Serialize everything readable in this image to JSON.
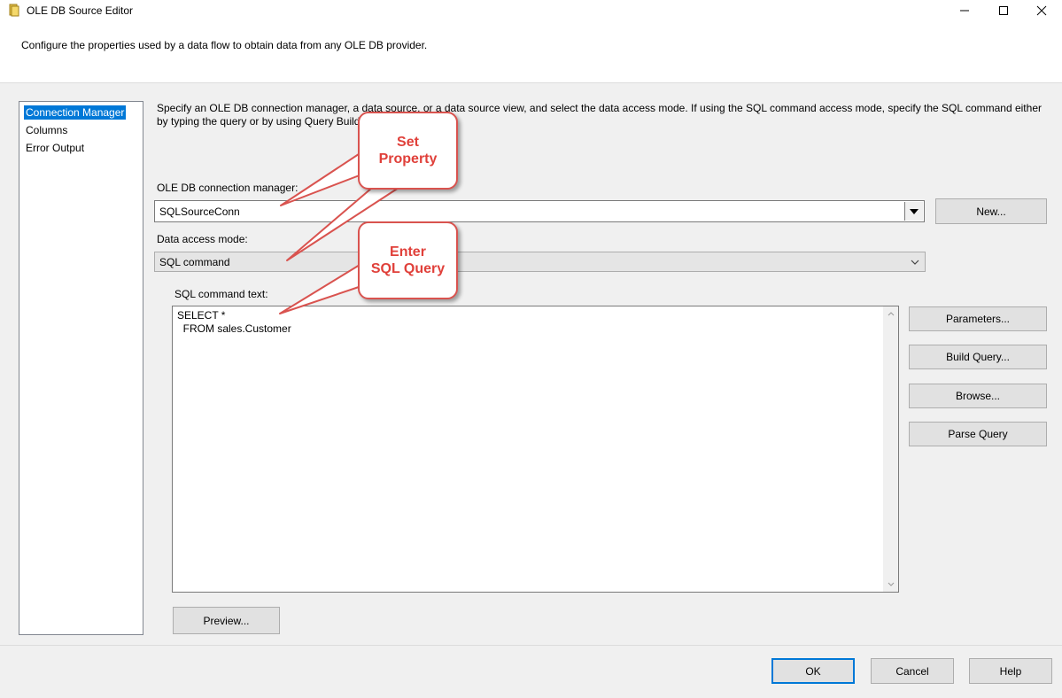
{
  "window": {
    "title": "OLE DB Source Editor"
  },
  "header": {
    "description": "Configure the properties used by a data flow to obtain data from any OLE DB provider."
  },
  "nav": {
    "items": [
      {
        "label": "Connection Manager"
      },
      {
        "label": "Columns"
      },
      {
        "label": "Error Output"
      }
    ]
  },
  "main": {
    "instructions": "Specify an OLE DB connection manager, a data source, or a data source view, and select the data access mode. If using the SQL command access mode, specify the SQL command either by typing the query or by using Query Builder.",
    "connection_manager_label": "OLE DB connection manager:",
    "connection_manager_value": "SQLSourceConn",
    "new_button": "New...",
    "data_access_mode_label": "Data access mode:",
    "data_access_mode_value": "SQL command",
    "sql_command_label": "SQL command text:",
    "sql_command_text": "SELECT *\n  FROM sales.Customer",
    "parameters_button": "Parameters...",
    "build_query_button": "Build Query...",
    "browse_button": "Browse...",
    "parse_query_button": "Parse Query",
    "preview_button": "Preview..."
  },
  "footer": {
    "ok_button": "OK",
    "cancel_button": "Cancel",
    "help_button": "Help"
  },
  "annotations": {
    "callout1_line1": "Set",
    "callout1_line2": "Property",
    "callout2_line1": "Enter",
    "callout2_line2": "SQL Query"
  },
  "colors": {
    "selection": "#0078d7",
    "callout": "#d9534f"
  }
}
